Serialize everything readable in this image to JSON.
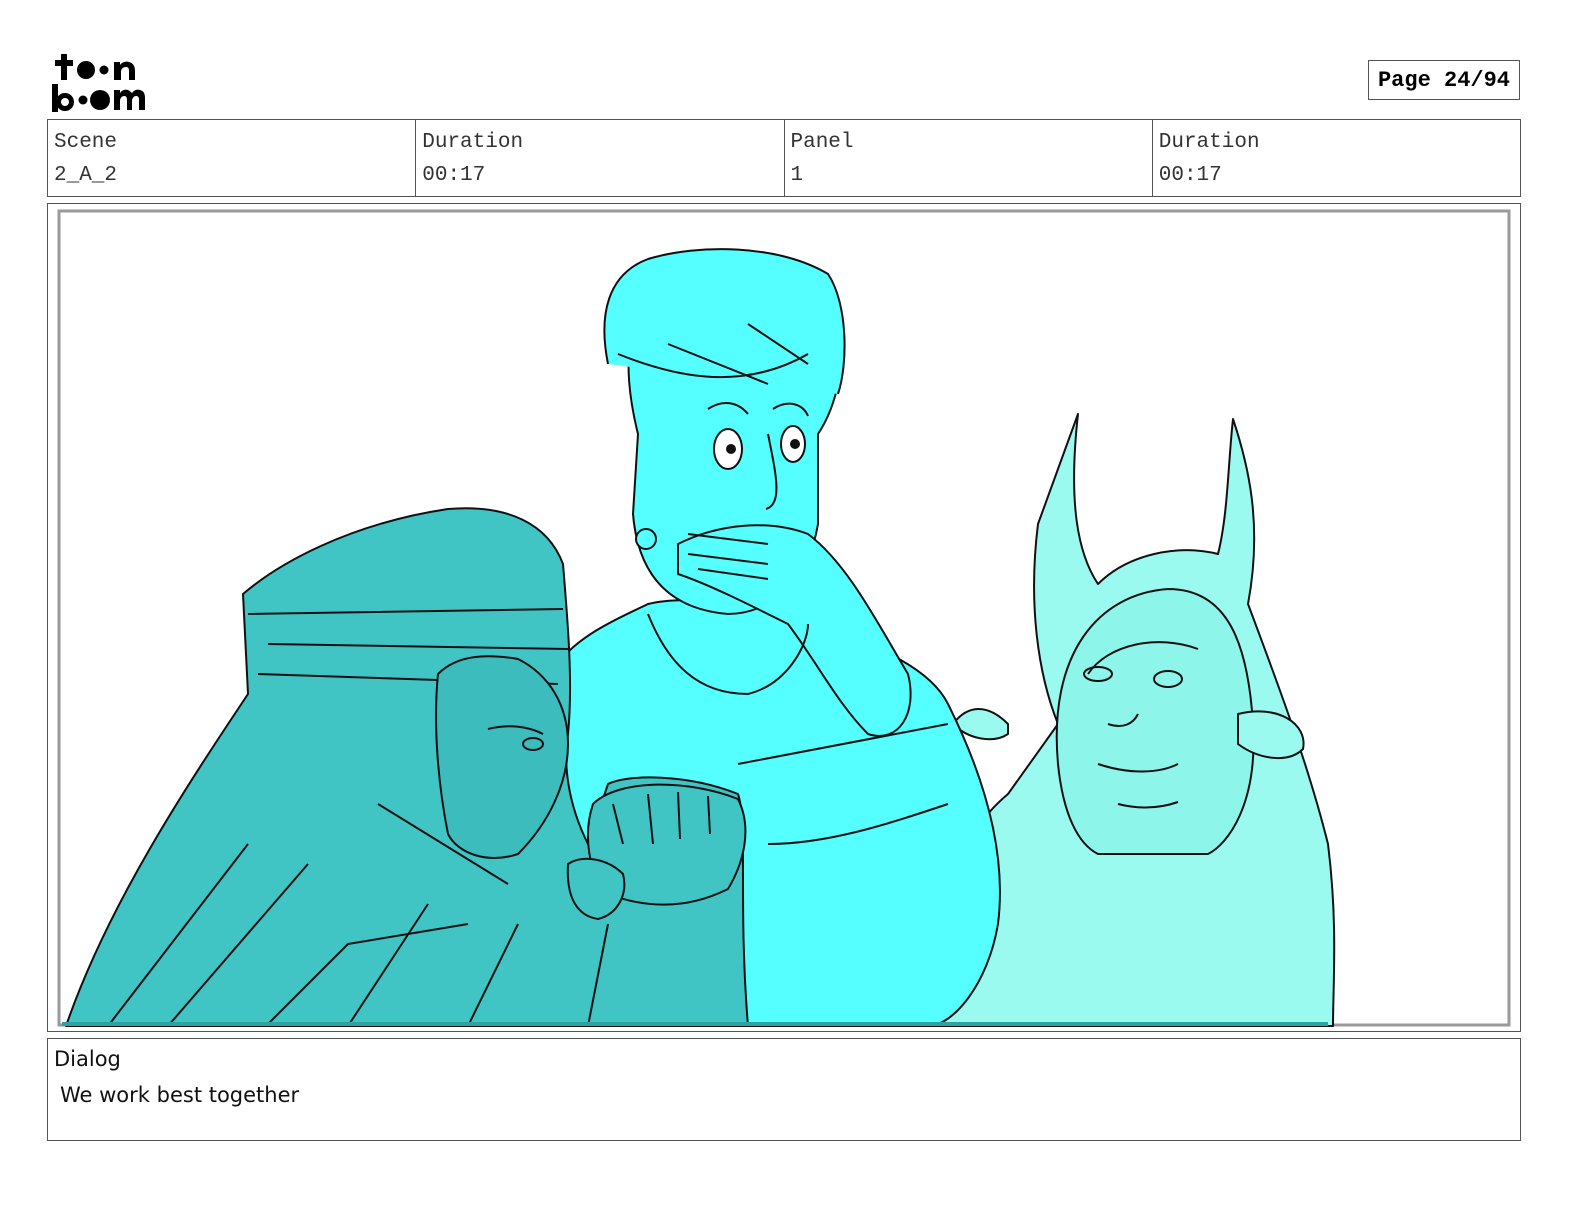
{
  "logo": {
    "line1": "toon",
    "line2": "boom",
    "icon": "toon-boom-logo"
  },
  "page_indicator": "Page 24/94",
  "info": {
    "scene_label": "Scene",
    "scene_value": "2_A_2",
    "duration_label": "Duration",
    "duration_value": "00:17",
    "panel_label": "Panel",
    "panel_value": "1",
    "panel_duration_label": "Duration",
    "panel_duration_value": "00:17"
  },
  "dialog": {
    "label": "Dialog",
    "text": "We work best together"
  },
  "colors": {
    "cyan": "#55ffff",
    "teal": "#40c4c4",
    "light_cyan": "#9bfaf0",
    "ink": "#111111"
  }
}
